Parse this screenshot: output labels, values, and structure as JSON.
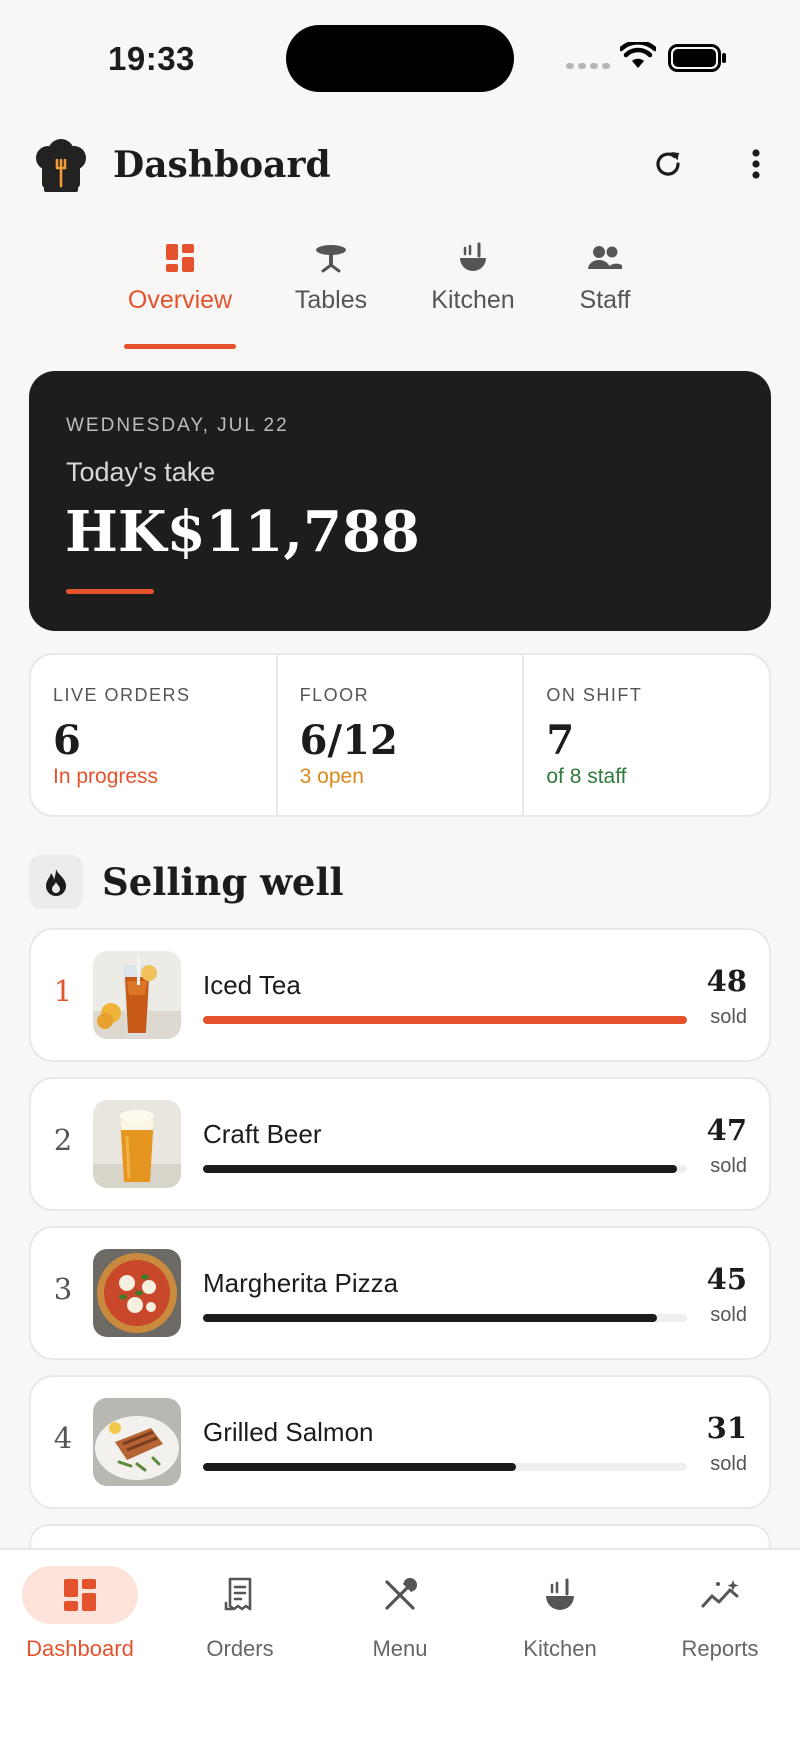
{
  "status_bar": {
    "time": "19:33"
  },
  "header": {
    "title": "Dashboard",
    "icons": {
      "logo": "chef-hat-icon",
      "refresh": "refresh-icon",
      "more": "more-vertical-icon"
    }
  },
  "tabs": [
    {
      "label": "Overview",
      "icon": "dashboard-grid-icon",
      "active": true
    },
    {
      "label": "Tables",
      "icon": "table-icon",
      "active": false
    },
    {
      "label": "Kitchen",
      "icon": "ladle-pot-icon",
      "active": false
    },
    {
      "label": "Staff",
      "icon": "people-icon",
      "active": false
    }
  ],
  "hero": {
    "date": "WEDNESDAY, JUL 22",
    "label": "Today's take",
    "amount": "HK$11,788"
  },
  "stats": [
    {
      "label": "LIVE ORDERS",
      "value": "6",
      "sub": "In progress",
      "sub_color": "#e4522e"
    },
    {
      "label": "FLOOR",
      "value": "6/12",
      "sub": "3 open",
      "sub_color": "#d98a1c"
    },
    {
      "label": "ON SHIFT",
      "value": "7",
      "sub": "of 8 staff",
      "sub_color": "#2f7a3a"
    }
  ],
  "selling": {
    "title": "Selling well",
    "icon": "flame-icon",
    "sold_label": "sold",
    "items": [
      {
        "rank": "1",
        "name": "Iced Tea",
        "count": "48",
        "level": 1.0
      },
      {
        "rank": "2",
        "name": "Craft Beer",
        "count": "47",
        "level": 0.979
      },
      {
        "rank": "3",
        "name": "Margherita Pizza",
        "count": "45",
        "level": 0.9375
      },
      {
        "rank": "4",
        "name": "Grilled Salmon",
        "count": "31",
        "level": 0.646
      }
    ]
  },
  "bottom_nav": [
    {
      "label": "Dashboard",
      "icon": "dashboard-grid-icon",
      "active": true
    },
    {
      "label": "Orders",
      "icon": "receipt-icon",
      "active": false
    },
    {
      "label": "Menu",
      "icon": "fork-knife-icon",
      "active": false
    },
    {
      "label": "Kitchen",
      "icon": "ladle-pot-icon",
      "active": false
    },
    {
      "label": "Reports",
      "icon": "sparkle-chart-icon",
      "active": false
    }
  ],
  "colors": {
    "accent": "#e4522e",
    "hero_bg": "#1d1d1d",
    "background": "#f8f7f5"
  }
}
